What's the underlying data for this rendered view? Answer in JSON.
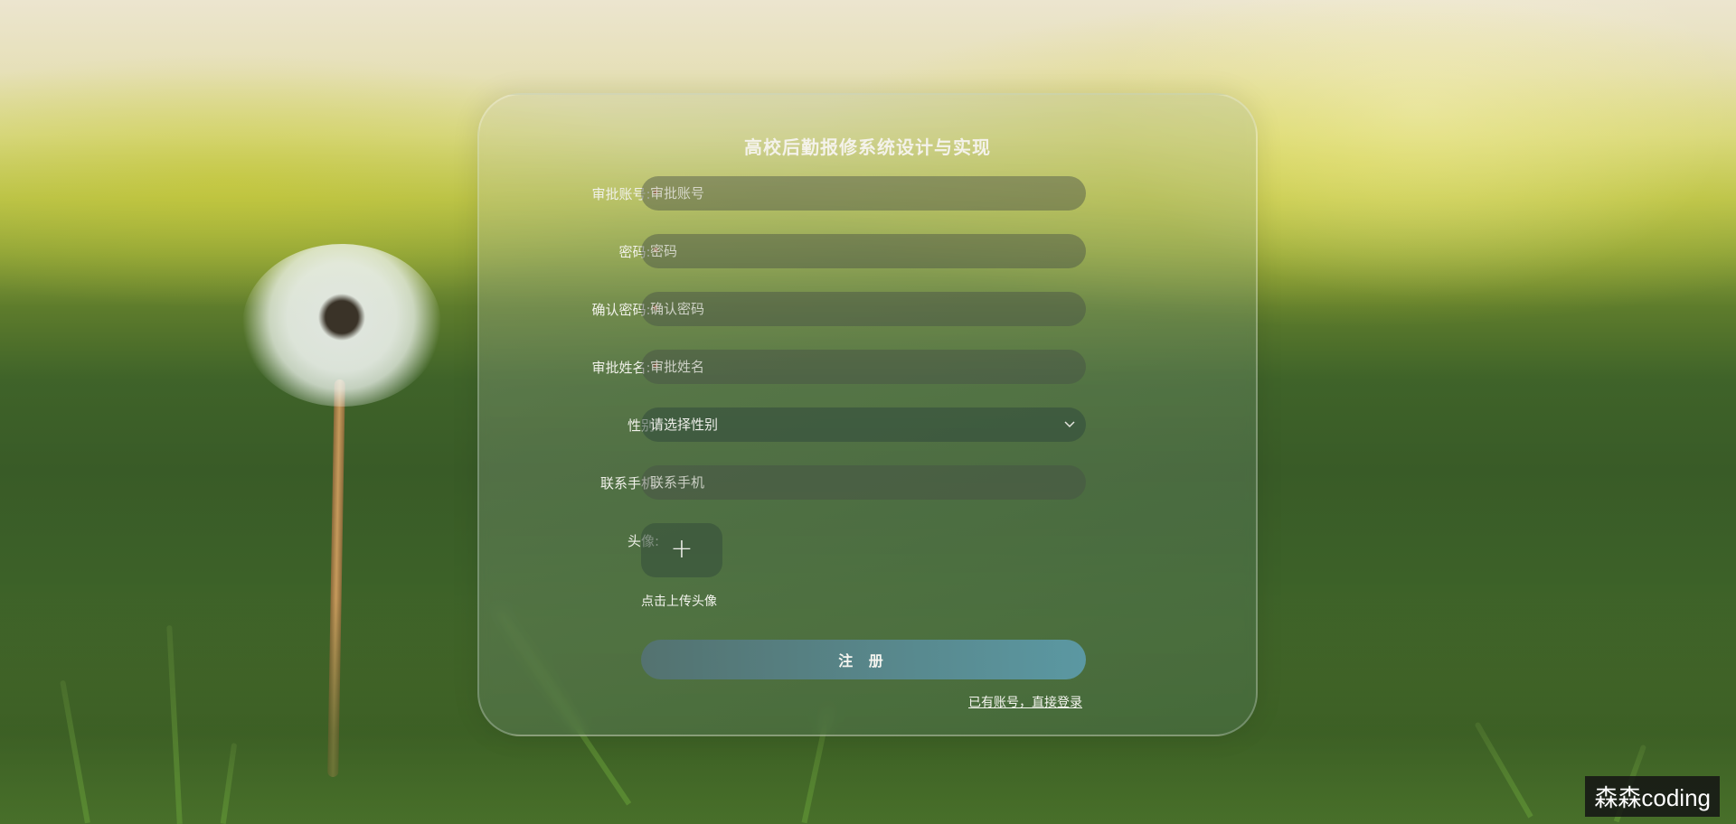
{
  "form": {
    "title": "高校后勤报修系统设计与实现",
    "fields": {
      "account": {
        "label": "审批账号:",
        "required": "*",
        "placeholder": "审批账号"
      },
      "password": {
        "label": "密码:",
        "required": "*",
        "placeholder": "密码"
      },
      "confirm_password": {
        "label": "确认密码:",
        "required": "*",
        "placeholder": "确认密码"
      },
      "name": {
        "label": "审批姓名:",
        "required": "*",
        "placeholder": "审批姓名"
      },
      "gender": {
        "label": "性别:",
        "selected": "请选择性别"
      },
      "phone": {
        "label": "联系手机:",
        "placeholder": "联系手机"
      },
      "avatar": {
        "label": "头像:",
        "plus": "+",
        "hint": "点击上传头像"
      }
    },
    "register_label": "注 册",
    "login_link": "已有账号，直接登录"
  },
  "watermark": "森森coding",
  "colors": {
    "required_star": "#e45b4c",
    "button_start": "#557378",
    "button_end": "#5fa0b4"
  },
  "icons": {
    "chevron": "chevron-down-icon",
    "plus": "plus-icon"
  }
}
